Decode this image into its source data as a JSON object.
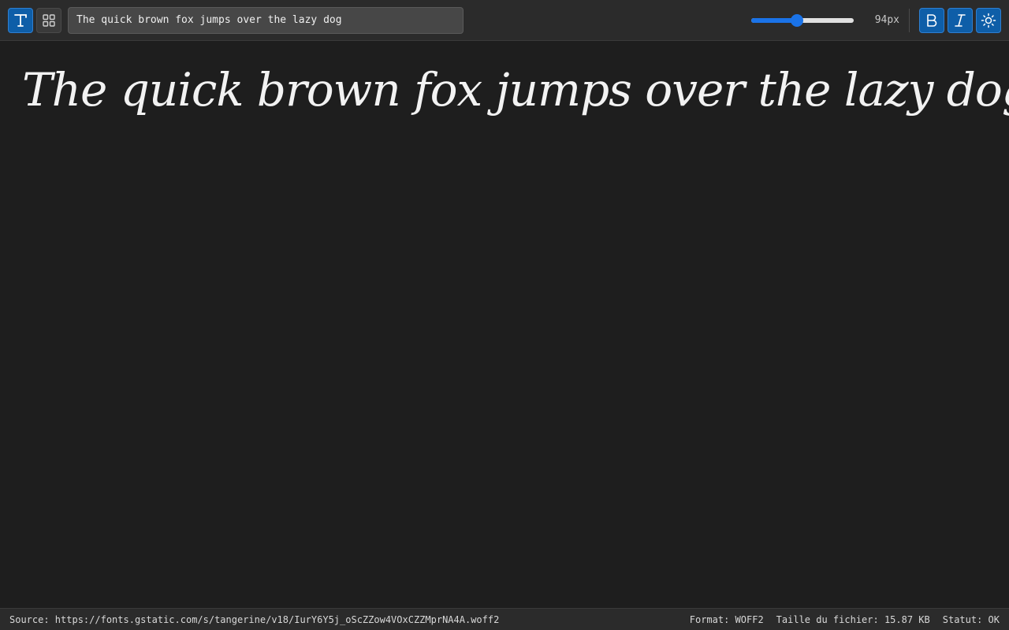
{
  "toolbar": {
    "modes": [
      {
        "name": "text-mode",
        "icon": "text-t-icon",
        "active": true
      },
      {
        "name": "grid-mode",
        "icon": "grid-icon",
        "active": false
      }
    ],
    "sample_text_value": "The quick brown fox jumps over the lazy dog",
    "size": {
      "value": 94,
      "min": 8,
      "max": 200,
      "label": "94px"
    },
    "style_buttons": [
      {
        "name": "bold",
        "icon": "bold-b-icon",
        "label": "B",
        "active": true
      },
      {
        "name": "italic",
        "icon": "italic-i-icon",
        "label": "I",
        "active": true
      },
      {
        "name": "theme",
        "icon": "sun-icon",
        "active": true
      }
    ]
  },
  "preview": {
    "text": "The quick brown fox jumps over the lazy dog"
  },
  "status": {
    "source": "Source: https://fonts.gstatic.com/s/tangerine/v18/IurY6Y5j_oScZZow4VOxCZZMprNA4A.woff2",
    "format": "Format: WOFF2",
    "file_size": "Taille du fichier: 15.87 KB",
    "state": "Statut: OK"
  },
  "colors": {
    "accent": "#1a73e8",
    "active_button": "#0e5ea8",
    "background": "#1e1e1e",
    "toolbar": "#2b2b2b"
  }
}
